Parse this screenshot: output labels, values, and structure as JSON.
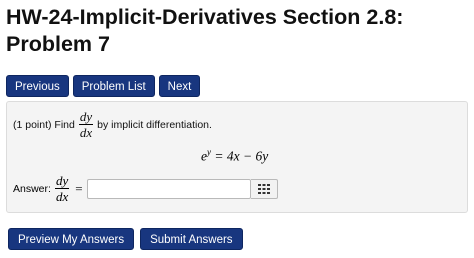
{
  "page": {
    "title": "HW-24-Implicit-Derivatives Section 2.8: Problem 7"
  },
  "nav": {
    "previous_label": "Previous",
    "problem_list_label": "Problem List",
    "next_label": "Next"
  },
  "problem": {
    "points": "(1 point) Find",
    "frac_num": "dy",
    "frac_den": "dx",
    "instruction": "by implicit differentiation.",
    "equation": {
      "base": "e",
      "exponent": "y",
      "rhs": "= 4x − 6y"
    }
  },
  "answer": {
    "label": "Answer:",
    "frac_num": "dy",
    "frac_den": "dx",
    "equals": "=",
    "value": "",
    "palette_icon": "grid-palette-icon"
  },
  "actions": {
    "preview_label": "Preview My Answers",
    "submit_label": "Submit Answers"
  },
  "colors": {
    "button_bg": "#18367f",
    "panel_bg": "#f4f4f4"
  }
}
